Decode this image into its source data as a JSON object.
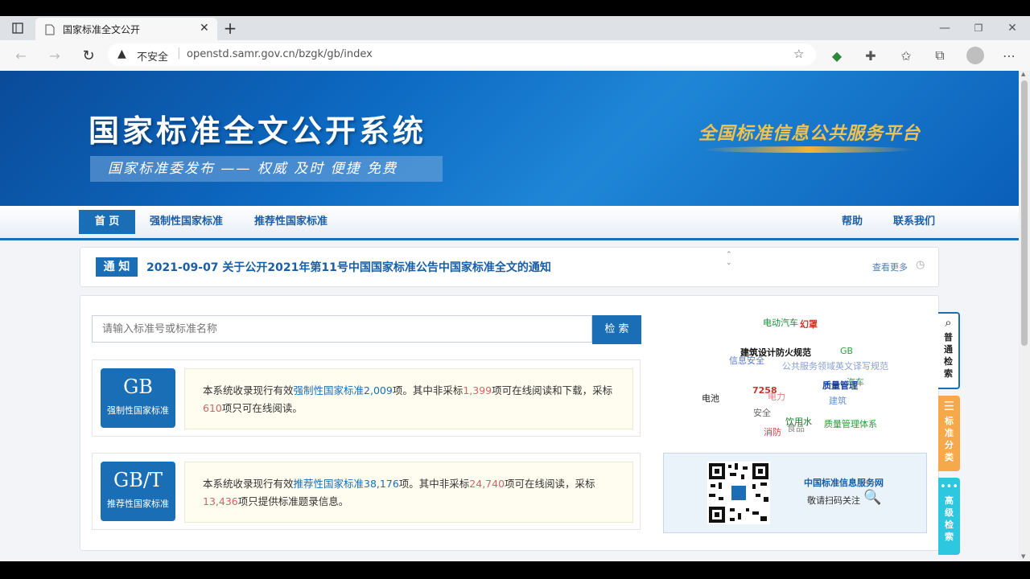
{
  "browser": {
    "tab_title": "国家标准全文公开",
    "new_tab": "+",
    "security": "不安全",
    "url": "openstd.samr.gov.cn/bzgk/gb/index",
    "window_controls": [
      "minimize-icon",
      "restore-icon",
      "close-icon"
    ]
  },
  "banner": {
    "title": "国家标准全文公开系统",
    "subtitle": "国家标准委发布 —— 权威 及时 便捷 免费",
    "slogan": "全国标准信息公共服务平台"
  },
  "nav": {
    "home": "首 页",
    "mandatory": "强制性国家标准",
    "recommended": "推荐性国家标准",
    "help": "帮助",
    "contact": "联系我们"
  },
  "notice": {
    "badge": "通 知",
    "text": "2021-09-07  关于公开2021年第11号中国国家标准公告中国家标准全文的通知",
    "more": "查看更多"
  },
  "search": {
    "placeholder": "请输入标准号或标准名称",
    "button": "检 索"
  },
  "gb": {
    "code": "GB",
    "name": "强制性国家标准",
    "desc_1": "本系统收录现行有效",
    "link": "强制性国家标准",
    "total": "2,009",
    "desc_2": "项。其中非采标",
    "non_adopted": "1,399",
    "desc_3": "项可在线阅读和下载，采标",
    "adopted": "610",
    "desc_4": "项只可在线阅读。"
  },
  "gbt": {
    "code": "GB/T",
    "name": "推荐性国家标准",
    "desc_1": "本系统收录现行有效",
    "link": "推荐性国家标准",
    "total": "38,176",
    "desc_2": "项。其中非采标",
    "non_adopted": "24,740",
    "desc_3": "项可在线阅读，采标",
    "adopted": "13,436",
    "desc_4": "项只提供标准题录信息。"
  },
  "wordcloud": [
    {
      "text": "电动汽车",
      "color": "#1a8a3a"
    },
    {
      "text": "幻罩",
      "color": "#c0392b"
    },
    {
      "text": "建筑设计防火规范",
      "color": "#111111"
    },
    {
      "text": "GB",
      "color": "#2e9e3e"
    },
    {
      "text": "信息安全",
      "color": "#5a7fc0"
    },
    {
      "text": "公共服务领域英文译写规范",
      "color": "#8aa0d0"
    },
    {
      "text": "质量管理",
      "color": "#1a3fa0"
    },
    {
      "text": "汽车",
      "color": "#2a9a5a"
    },
    {
      "text": "电池",
      "color": "#222222"
    },
    {
      "text": "7258",
      "color": "#c0392b"
    },
    {
      "text": "电力",
      "color": "#e08080"
    },
    {
      "text": "建筑",
      "color": "#6a8fd0"
    },
    {
      "text": "安全",
      "color": "#666666"
    },
    {
      "text": "饮用水",
      "color": "#1a7a2a"
    },
    {
      "text": "食品",
      "color": "#888888"
    },
    {
      "text": "质量管理体系",
      "color": "#2a9a3a"
    },
    {
      "text": "消防",
      "color": "#d04040"
    }
  ],
  "qr": {
    "title": "中国标准信息服务网",
    "subtitle": "敬请扫码关注"
  },
  "side_tabs": {
    "normal": [
      "普",
      "通",
      "检",
      "索"
    ],
    "classify": [
      "标",
      "准",
      "分",
      "类"
    ],
    "advanced": [
      "高",
      "级",
      "检",
      "索"
    ]
  },
  "colors": {
    "brand": "#1a6eb5",
    "orange": "#f5a94a",
    "cyan": "#2ec7e0",
    "highlight": "#d9534f"
  }
}
